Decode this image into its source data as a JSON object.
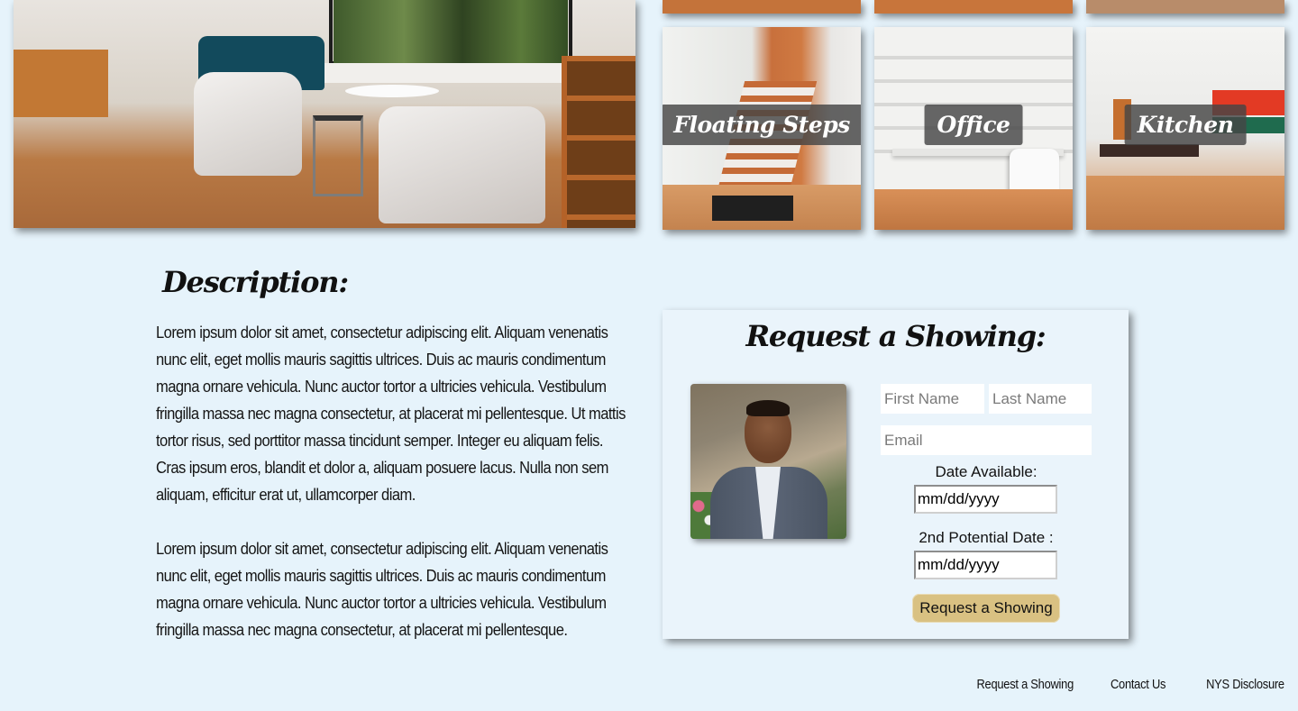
{
  "gallery": {
    "thumbnails": [
      {
        "label": "Floating Steps"
      },
      {
        "label": "Office"
      },
      {
        "label": "Kitchen"
      }
    ]
  },
  "description": {
    "title": "Description:",
    "paragraphs": [
      "Lorem ipsum dolor sit amet, consectetur adipiscing elit. Aliquam venenatis nunc elit, eget mollis mauris sagittis ultrices. Duis ac mauris condimentum magna ornare vehicula. Nunc auctor tortor a ultricies vehicula. Vestibulum fringilla massa nec magna consectetur, at placerat mi pellentesque. Ut mattis tortor risus, sed porttitor massa tincidunt semper. Integer eu aliquam felis. Cras ipsum eros, blandit et dolor a, aliquam posuere lacus. Nulla non sem aliquam, efficitur erat ut, ullamcorper diam.",
      "Lorem ipsum dolor sit amet, consectetur adipiscing elit. Aliquam venenatis nunc elit, eget mollis mauris sagittis ultrices. Duis ac mauris condimentum magna ornare vehicula. Nunc auctor tortor a ultricies vehicula. Vestibulum fringilla massa nec magna consectetur, at placerat mi pellentesque."
    ]
  },
  "request_form": {
    "title": "Request a Showing:",
    "first_name_placeholder": "First Name",
    "last_name_placeholder": "Last Name",
    "email_placeholder": "Email",
    "date_available_label": "Date Available:",
    "date_placeholder": "mm/dd/yyyy",
    "second_date_label": "2nd Potential Date :",
    "second_date_placeholder": "mm/dd/yyyy",
    "submit_label": "Request a Showing"
  },
  "footer": {
    "links": [
      "Request a Showing",
      "Contact Us",
      "NYS Disclosure"
    ]
  },
  "colors": {
    "page_background": "#e6f3fb",
    "button_background": "#d9c182",
    "label_overlay": "#464646"
  }
}
